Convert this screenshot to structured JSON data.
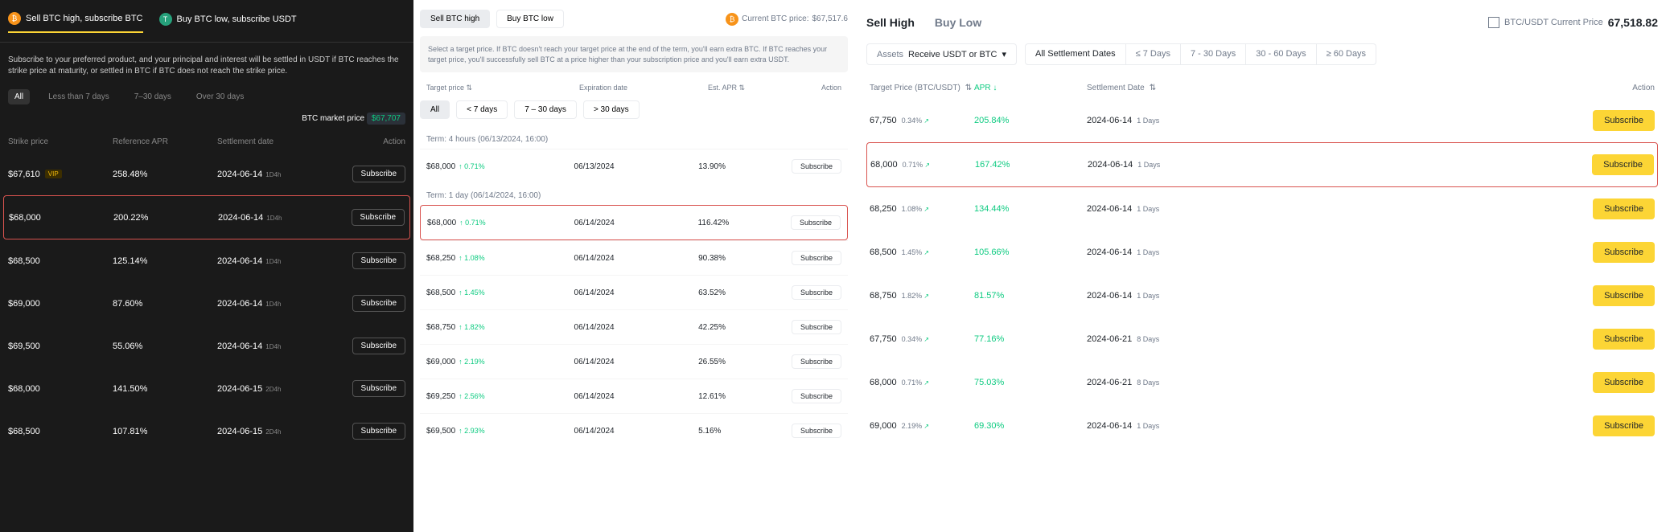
{
  "panel1": {
    "tabs": [
      {
        "label": "Sell BTC high, subscribe BTC"
      },
      {
        "label": "Buy BTC low, subscribe USDT"
      }
    ],
    "desc": "Subscribe to your preferred product, and your principal and interest will be settled in USDT if BTC reaches the strike price at maturity, or settled in BTC if BTC does not reach the strike price.",
    "filters": [
      "All",
      "Less than 7 days",
      "7–30 days",
      "Over 30 days"
    ],
    "market_label": "BTC market price",
    "market_value": "$67,707",
    "headers": {
      "strike": "Strike price",
      "apr": "Reference APR",
      "settle": "Settlement date",
      "action": "Action"
    },
    "subscribe": "Subscribe",
    "vip": "VIP",
    "rows": [
      {
        "strike": "$67,610",
        "vip": true,
        "apr": "258.48%",
        "date": "2024-06-14",
        "term": "1D4h",
        "hl": false
      },
      {
        "strike": "$68,000",
        "vip": false,
        "apr": "200.22%",
        "date": "2024-06-14",
        "term": "1D4h",
        "hl": true
      },
      {
        "strike": "$68,500",
        "vip": false,
        "apr": "125.14%",
        "date": "2024-06-14",
        "term": "1D4h",
        "hl": false
      },
      {
        "strike": "$69,000",
        "vip": false,
        "apr": "87.60%",
        "date": "2024-06-14",
        "term": "1D4h",
        "hl": false
      },
      {
        "strike": "$69,500",
        "vip": false,
        "apr": "55.06%",
        "date": "2024-06-14",
        "term": "1D4h",
        "hl": false
      },
      {
        "strike": "$68,000",
        "vip": false,
        "apr": "141.50%",
        "date": "2024-06-15",
        "term": "2D4h",
        "hl": false
      },
      {
        "strike": "$68,500",
        "vip": false,
        "apr": "107.81%",
        "date": "2024-06-15",
        "term": "2D4h",
        "hl": false
      }
    ]
  },
  "panel2": {
    "tabs": [
      "Sell BTC high",
      "Buy BTC low"
    ],
    "price_label": "Current BTC price:",
    "price_value": "$67,517.6",
    "desc": "Select a target price. If BTC doesn't reach your target price at the end of the term, you'll earn extra BTC. If BTC reaches your target price, you'll successfully sell BTC at a price higher than your subscription price and you'll earn extra USDT.",
    "headers": {
      "tp": "Target price",
      "exp": "Expiration date",
      "apr": "Est. APR",
      "action": "Action"
    },
    "filters": [
      "All",
      "< 7 days",
      "7 – 30 days",
      "> 30 days"
    ],
    "subscribe": "Subscribe",
    "groups": [
      {
        "label": "Term: 4 hours (06/13/2024, 16:00)",
        "rows": [
          {
            "tp": "$68,000",
            "pct": "↑ 0.71%",
            "exp": "06/13/2024",
            "apr": "13.90%",
            "hl": false
          }
        ]
      },
      {
        "label": "Term: 1 day (06/14/2024, 16:00)",
        "rows": [
          {
            "tp": "$68,000",
            "pct": "↑ 0.71%",
            "exp": "06/14/2024",
            "apr": "116.42%",
            "hl": true
          },
          {
            "tp": "$68,250",
            "pct": "↑ 1.08%",
            "exp": "06/14/2024",
            "apr": "90.38%",
            "hl": false
          },
          {
            "tp": "$68,500",
            "pct": "↑ 1.45%",
            "exp": "06/14/2024",
            "apr": "63.52%",
            "hl": false
          },
          {
            "tp": "$68,750",
            "pct": "↑ 1.82%",
            "exp": "06/14/2024",
            "apr": "42.25%",
            "hl": false
          },
          {
            "tp": "$69,000",
            "pct": "↑ 2.19%",
            "exp": "06/14/2024",
            "apr": "26.55%",
            "hl": false
          },
          {
            "tp": "$69,250",
            "pct": "↑ 2.56%",
            "exp": "06/14/2024",
            "apr": "12.61%",
            "hl": false
          },
          {
            "tp": "$69,500",
            "pct": "↑ 2.93%",
            "exp": "06/14/2024",
            "apr": "5.16%",
            "hl": false
          }
        ]
      }
    ]
  },
  "panel3": {
    "tabs": [
      "Sell High",
      "Buy Low"
    ],
    "price_label": "BTC/USDT Current Price",
    "price_value": "67,518.82",
    "asset_label": "Assets",
    "asset_value": "Receive USDT or BTC",
    "durations": [
      "All Settlement Dates",
      "≤ 7 Days",
      "7 - 30 Days",
      "30 - 60 Days",
      "≥ 60 Days"
    ],
    "headers": {
      "tp": "Target Price (BTC/USDT)",
      "apr": "APR",
      "sd": "Settlement Date",
      "action": "Action"
    },
    "subscribe": "Subscribe",
    "rows": [
      {
        "tp": "67,750",
        "pct": "0.34%",
        "apr": "205.84%",
        "date": "2024-06-14",
        "days": "1 Days",
        "hl": false
      },
      {
        "tp": "68,000",
        "pct": "0.71%",
        "apr": "167.42%",
        "date": "2024-06-14",
        "days": "1 Days",
        "hl": true
      },
      {
        "tp": "68,250",
        "pct": "1.08%",
        "apr": "134.44%",
        "date": "2024-06-14",
        "days": "1 Days",
        "hl": false
      },
      {
        "tp": "68,500",
        "pct": "1.45%",
        "apr": "105.66%",
        "date": "2024-06-14",
        "days": "1 Days",
        "hl": false
      },
      {
        "tp": "68,750",
        "pct": "1.82%",
        "apr": "81.57%",
        "date": "2024-06-14",
        "days": "1 Days",
        "hl": false
      },
      {
        "tp": "67,750",
        "pct": "0.34%",
        "apr": "77.16%",
        "date": "2024-06-21",
        "days": "8 Days",
        "hl": false
      },
      {
        "tp": "68,000",
        "pct": "0.71%",
        "apr": "75.03%",
        "date": "2024-06-21",
        "days": "8 Days",
        "hl": false
      },
      {
        "tp": "69,000",
        "pct": "2.19%",
        "apr": "69.30%",
        "date": "2024-06-14",
        "days": "1 Days",
        "hl": false
      }
    ]
  }
}
